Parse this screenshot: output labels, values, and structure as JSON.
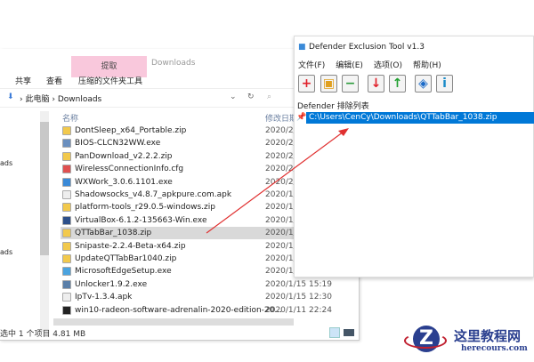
{
  "explorer": {
    "ribbon_tab_extract": "提取",
    "window_title": "Downloads",
    "tabs": [
      "共享",
      "查看",
      "压缩的文件夹工具"
    ],
    "breadcrumb": [
      "此电脑",
      "Downloads"
    ],
    "sidebar_items": [
      "ads",
      "ads"
    ],
    "col_name": "名称",
    "col_date": "修改日期",
    "files": [
      {
        "name": "DontSleep_x64_Portable.zip",
        "date": "2020/2/",
        "color": "#f2c94c"
      },
      {
        "name": "BIOS-CLCN32WW.exe",
        "date": "2020/2/",
        "color": "#6a8fbf"
      },
      {
        "name": "PanDownload_v2.2.2.zip",
        "date": "2020/2/",
        "color": "#f2c94c"
      },
      {
        "name": "WirelessConnectionInfo.cfg",
        "date": "2020/2/",
        "color": "#e05050"
      },
      {
        "name": "WXWork_3.0.6.1101.exe",
        "date": "2020/2/",
        "color": "#3a8ad8"
      },
      {
        "name": "Shadowsocks_v4.8.7_apkpure.com.apk",
        "date": "2020/1/",
        "color": "#eeeeee"
      },
      {
        "name": "platform-tools_r29.0.5-windows.zip",
        "date": "2020/1/",
        "color": "#f2c94c"
      },
      {
        "name": "VirtualBox-6.1.2-135663-Win.exe",
        "date": "2020/1/",
        "color": "#2c4f8a"
      },
      {
        "name": "QTTabBar_1038.zip",
        "date": "2020/1/",
        "color": "#f2c94c",
        "selected": true
      },
      {
        "name": "Snipaste-2.2.4-Beta-x64.zip",
        "date": "2020/1/",
        "color": "#f2c94c"
      },
      {
        "name": "UpdateQTTabBar1040.zip",
        "date": "2020/1/",
        "color": "#f2c94c"
      },
      {
        "name": "MicrosoftEdgeSetup.exe",
        "date": "2020/1/",
        "color": "#4aa3df"
      },
      {
        "name": "Unlocker1.9.2.exe",
        "date": "2020/1/15 15:19",
        "color": "#5a7fa8"
      },
      {
        "name": "IpTv-1.3.4.apk",
        "date": "2020/1/15 12:30",
        "color": "#eeeeee"
      },
      {
        "name": "win10-radeon-software-adrenalin-2020-edition-20...",
        "date": "2020/1/11 22:24",
        "color": "#222222"
      }
    ],
    "status": "选中 1 个项目  4.81 MB"
  },
  "defender": {
    "title": "Defender Exclusion Tool v1.3",
    "menu": [
      "文件(F)",
      "编辑(E)",
      "选项(O)",
      "帮助(H)"
    ],
    "toolbar": [
      {
        "name": "add-icon",
        "glyph": "+",
        "color": "#e0202a"
      },
      {
        "name": "add-folder-icon",
        "glyph": "▣",
        "color": "#e0a020"
      },
      {
        "name": "remove-icon",
        "glyph": "−",
        "color": "#2a9a3a"
      },
      {
        "name": "import-icon",
        "glyph": "↓",
        "color": "#e0202a"
      },
      {
        "name": "export-icon",
        "glyph": "↑",
        "color": "#20a030"
      },
      {
        "name": "defender-shield-icon",
        "glyph": "◈",
        "color": "#1a6ac8"
      },
      {
        "name": "info-icon",
        "glyph": "i",
        "color": "#1a8ac8"
      }
    ],
    "list_label": "Defender 排除列表",
    "entries": [
      "C:\\Users\\CenCy\\Downloads\\QTTabBar_1038.zip"
    ],
    "accent": "#0078d7"
  },
  "watermark": {
    "cn": "这里教程网",
    "en": "herecours.com"
  }
}
